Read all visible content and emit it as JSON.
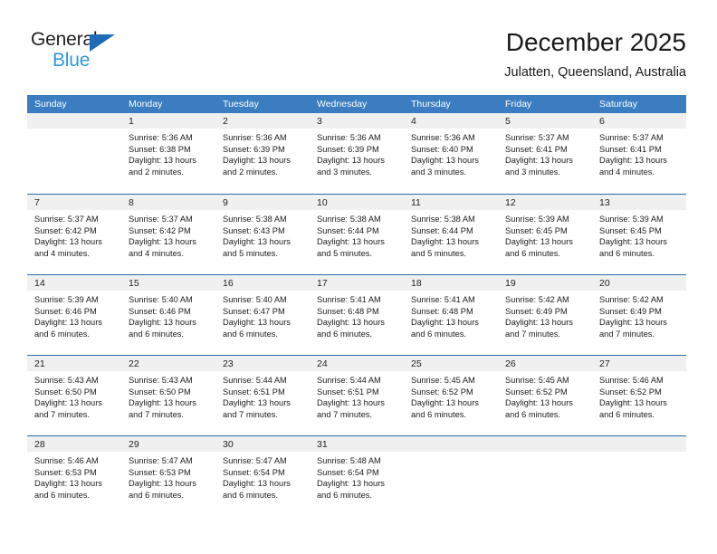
{
  "brand": {
    "name_top": "General",
    "name_bottom": "Blue",
    "triangle_color": "#1e6cb5",
    "top_color": "#231f20",
    "bottom_color": "#2e97e0"
  },
  "header": {
    "title": "December 2025",
    "subtitle": "Julatten, Queensland, Australia"
  },
  "theme": {
    "header_band": "#3b7dc0",
    "row_divider": "#2f6cab",
    "day_strip": "#f0f0f0",
    "text": "#1c1c1c"
  },
  "weekdays": [
    "Sunday",
    "Monday",
    "Tuesday",
    "Wednesday",
    "Thursday",
    "Friday",
    "Saturday"
  ],
  "weeks": [
    [
      {
        "day": "",
        "lines": []
      },
      {
        "day": "1",
        "lines": [
          "Sunrise: 5:36 AM",
          "Sunset: 6:38 PM",
          "Daylight: 13 hours",
          "and 2 minutes."
        ]
      },
      {
        "day": "2",
        "lines": [
          "Sunrise: 5:36 AM",
          "Sunset: 6:39 PM",
          "Daylight: 13 hours",
          "and 2 minutes."
        ]
      },
      {
        "day": "3",
        "lines": [
          "Sunrise: 5:36 AM",
          "Sunset: 6:39 PM",
          "Daylight: 13 hours",
          "and 3 minutes."
        ]
      },
      {
        "day": "4",
        "lines": [
          "Sunrise: 5:36 AM",
          "Sunset: 6:40 PM",
          "Daylight: 13 hours",
          "and 3 minutes."
        ]
      },
      {
        "day": "5",
        "lines": [
          "Sunrise: 5:37 AM",
          "Sunset: 6:41 PM",
          "Daylight: 13 hours",
          "and 3 minutes."
        ]
      },
      {
        "day": "6",
        "lines": [
          "Sunrise: 5:37 AM",
          "Sunset: 6:41 PM",
          "Daylight: 13 hours",
          "and 4 minutes."
        ]
      }
    ],
    [
      {
        "day": "7",
        "lines": [
          "Sunrise: 5:37 AM",
          "Sunset: 6:42 PM",
          "Daylight: 13 hours",
          "and 4 minutes."
        ]
      },
      {
        "day": "8",
        "lines": [
          "Sunrise: 5:37 AM",
          "Sunset: 6:42 PM",
          "Daylight: 13 hours",
          "and 4 minutes."
        ]
      },
      {
        "day": "9",
        "lines": [
          "Sunrise: 5:38 AM",
          "Sunset: 6:43 PM",
          "Daylight: 13 hours",
          "and 5 minutes."
        ]
      },
      {
        "day": "10",
        "lines": [
          "Sunrise: 5:38 AM",
          "Sunset: 6:44 PM",
          "Daylight: 13 hours",
          "and 5 minutes."
        ]
      },
      {
        "day": "11",
        "lines": [
          "Sunrise: 5:38 AM",
          "Sunset: 6:44 PM",
          "Daylight: 13 hours",
          "and 5 minutes."
        ]
      },
      {
        "day": "12",
        "lines": [
          "Sunrise: 5:39 AM",
          "Sunset: 6:45 PM",
          "Daylight: 13 hours",
          "and 6 minutes."
        ]
      },
      {
        "day": "13",
        "lines": [
          "Sunrise: 5:39 AM",
          "Sunset: 6:45 PM",
          "Daylight: 13 hours",
          "and 6 minutes."
        ]
      }
    ],
    [
      {
        "day": "14",
        "lines": [
          "Sunrise: 5:39 AM",
          "Sunset: 6:46 PM",
          "Daylight: 13 hours",
          "and 6 minutes."
        ]
      },
      {
        "day": "15",
        "lines": [
          "Sunrise: 5:40 AM",
          "Sunset: 6:46 PM",
          "Daylight: 13 hours",
          "and 6 minutes."
        ]
      },
      {
        "day": "16",
        "lines": [
          "Sunrise: 5:40 AM",
          "Sunset: 6:47 PM",
          "Daylight: 13 hours",
          "and 6 minutes."
        ]
      },
      {
        "day": "17",
        "lines": [
          "Sunrise: 5:41 AM",
          "Sunset: 6:48 PM",
          "Daylight: 13 hours",
          "and 6 minutes."
        ]
      },
      {
        "day": "18",
        "lines": [
          "Sunrise: 5:41 AM",
          "Sunset: 6:48 PM",
          "Daylight: 13 hours",
          "and 6 minutes."
        ]
      },
      {
        "day": "19",
        "lines": [
          "Sunrise: 5:42 AM",
          "Sunset: 6:49 PM",
          "Daylight: 13 hours",
          "and 7 minutes."
        ]
      },
      {
        "day": "20",
        "lines": [
          "Sunrise: 5:42 AM",
          "Sunset: 6:49 PM",
          "Daylight: 13 hours",
          "and 7 minutes."
        ]
      }
    ],
    [
      {
        "day": "21",
        "lines": [
          "Sunrise: 5:43 AM",
          "Sunset: 6:50 PM",
          "Daylight: 13 hours",
          "and 7 minutes."
        ]
      },
      {
        "day": "22",
        "lines": [
          "Sunrise: 5:43 AM",
          "Sunset: 6:50 PM",
          "Daylight: 13 hours",
          "and 7 minutes."
        ]
      },
      {
        "day": "23",
        "lines": [
          "Sunrise: 5:44 AM",
          "Sunset: 6:51 PM",
          "Daylight: 13 hours",
          "and 7 minutes."
        ]
      },
      {
        "day": "24",
        "lines": [
          "Sunrise: 5:44 AM",
          "Sunset: 6:51 PM",
          "Daylight: 13 hours",
          "and 7 minutes."
        ]
      },
      {
        "day": "25",
        "lines": [
          "Sunrise: 5:45 AM",
          "Sunset: 6:52 PM",
          "Daylight: 13 hours",
          "and 6 minutes."
        ]
      },
      {
        "day": "26",
        "lines": [
          "Sunrise: 5:45 AM",
          "Sunset: 6:52 PM",
          "Daylight: 13 hours",
          "and 6 minutes."
        ]
      },
      {
        "day": "27",
        "lines": [
          "Sunrise: 5:46 AM",
          "Sunset: 6:52 PM",
          "Daylight: 13 hours",
          "and 6 minutes."
        ]
      }
    ],
    [
      {
        "day": "28",
        "lines": [
          "Sunrise: 5:46 AM",
          "Sunset: 6:53 PM",
          "Daylight: 13 hours",
          "and 6 minutes."
        ]
      },
      {
        "day": "29",
        "lines": [
          "Sunrise: 5:47 AM",
          "Sunset: 6:53 PM",
          "Daylight: 13 hours",
          "and 6 minutes."
        ]
      },
      {
        "day": "30",
        "lines": [
          "Sunrise: 5:47 AM",
          "Sunset: 6:54 PM",
          "Daylight: 13 hours",
          "and 6 minutes."
        ]
      },
      {
        "day": "31",
        "lines": [
          "Sunrise: 5:48 AM",
          "Sunset: 6:54 PM",
          "Daylight: 13 hours",
          "and 6 minutes."
        ]
      },
      {
        "day": "",
        "lines": []
      },
      {
        "day": "",
        "lines": []
      },
      {
        "day": "",
        "lines": []
      }
    ]
  ]
}
